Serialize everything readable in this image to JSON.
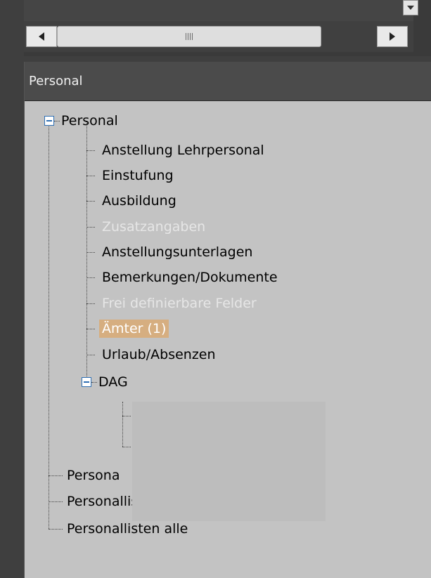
{
  "scroll": {
    "thumb_grip": "III",
    "left_arrow": "◀",
    "right_arrow": "▶",
    "down_arrow": "▼"
  },
  "panel": {
    "title": "Personal"
  },
  "tree": {
    "root": "Personal",
    "items": [
      {
        "label": "Anstellung Lehrpersonal",
        "state": "normal"
      },
      {
        "label": "Einstufung",
        "state": "normal"
      },
      {
        "label": "Ausbildung",
        "state": "normal"
      },
      {
        "label": "Zusatzangaben",
        "state": "disabled"
      },
      {
        "label": "Anstellungsunterlagen",
        "state": "normal"
      },
      {
        "label": "Bemerkungen/Dokumente",
        "state": "normal"
      },
      {
        "label": "Frei definierbare Felder",
        "state": "disabled"
      },
      {
        "label": "Ämter  (1)",
        "state": "selected"
      },
      {
        "label": "Urlaub/Absenzen",
        "state": "normal"
      }
    ],
    "dag": "DAG",
    "bottom_items": [
      {
        "label": "Persona"
      },
      {
        "label": "Personallisten"
      },
      {
        "label": "Personallisten alle"
      }
    ]
  },
  "colors": {
    "selected_bg": "#d6ae80",
    "tree_bg": "#c3c3c3",
    "header_bg": "#4b4b4b"
  }
}
